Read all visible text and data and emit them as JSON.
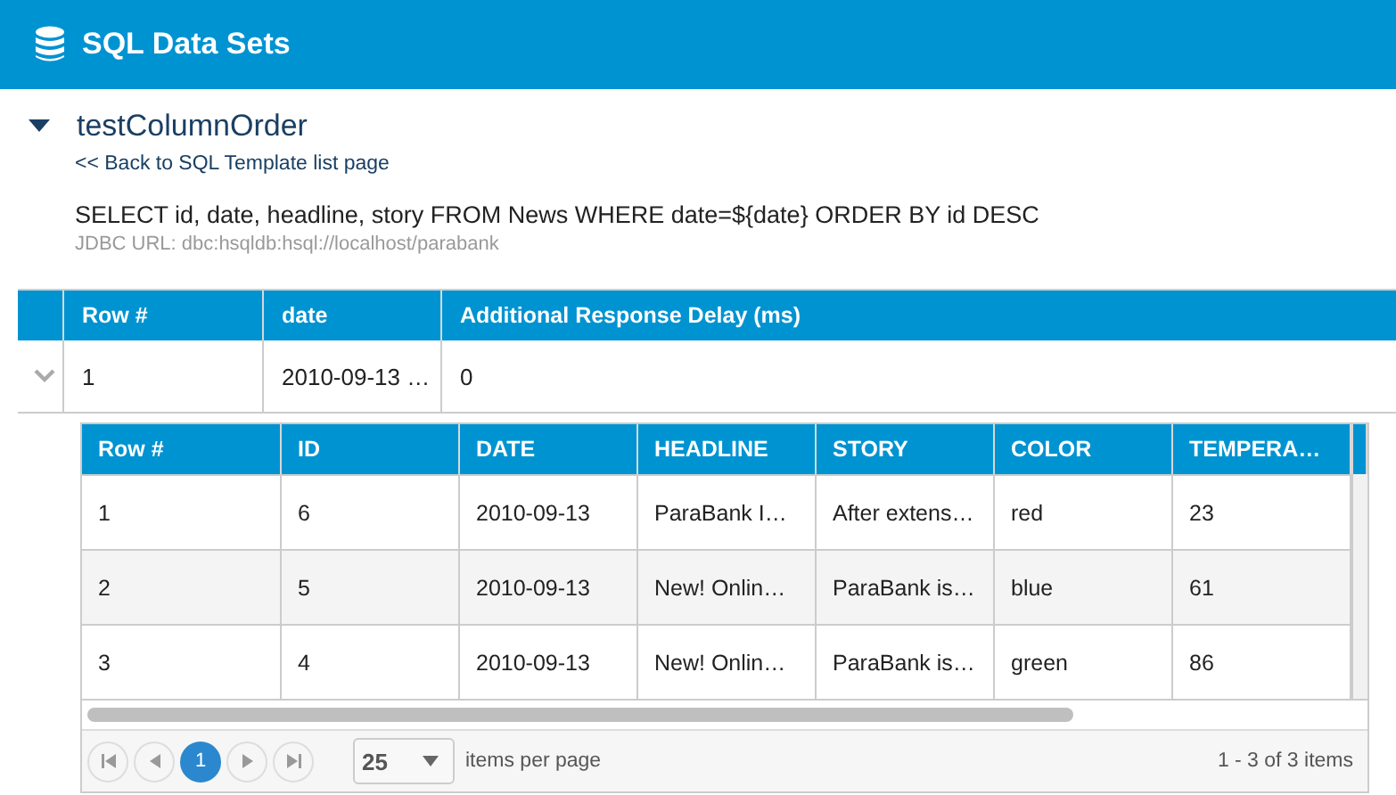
{
  "header": {
    "title": "SQL Data Sets"
  },
  "dataset": {
    "name": "testColumnOrder",
    "expanded": true,
    "back_link": "<< Back to SQL Template list page",
    "query": "SELECT id, date, headline, story FROM News WHERE date=${date} ORDER BY id DESC",
    "jdbc_url": "JDBC URL: dbc:hsqldb:hsql://localhost/parabank"
  },
  "outer_table": {
    "columns": [
      "Row #",
      "date",
      "Additional Response Delay (ms)"
    ],
    "rows": [
      {
        "expanded": true,
        "cells": [
          "1",
          "2010-09-13 …",
          "0"
        ]
      }
    ]
  },
  "inner_table": {
    "columns": [
      "Row #",
      "ID",
      "DATE",
      "HEADLINE",
      "STORY",
      "COLOR",
      "TEMPERA…"
    ],
    "rows": [
      [
        "1",
        "6",
        "2010-09-13",
        "ParaBank I…",
        "After extens…",
        "red",
        "23"
      ],
      [
        "2",
        "5",
        "2010-09-13",
        "New! Onlin…",
        "ParaBank is…",
        "blue",
        "61"
      ],
      [
        "3",
        "4",
        "2010-09-13",
        "New! Onlin…",
        "ParaBank is…",
        "green",
        "86"
      ]
    ]
  },
  "pager": {
    "pages": [
      {
        "label": "1",
        "selected": true
      }
    ],
    "page_size": "25",
    "page_size_label": "items per page",
    "summary": "1 - 3 of 3 items"
  }
}
